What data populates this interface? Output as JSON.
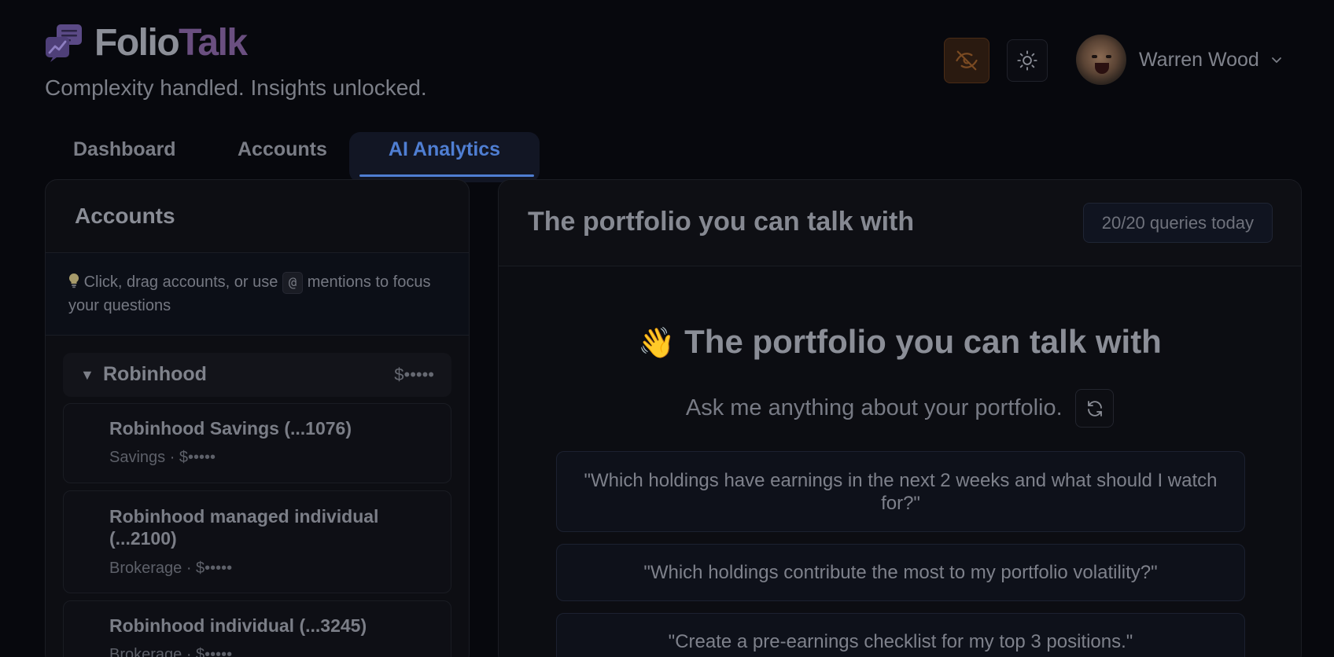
{
  "app": {
    "brand_part1": "Folio",
    "brand_part2": "Talk",
    "tagline": "Complexity handled. Insights unlocked."
  },
  "header": {
    "user_name": "Warren Wood",
    "icons": {
      "privacy_toggle": "eye-off-icon",
      "theme_toggle": "sun-icon",
      "user_menu": "chevron-down-icon"
    },
    "accent_colors": {
      "privacy_button": "#2a1a10",
      "active_tab": "#4f7ed2"
    }
  },
  "tabs": [
    {
      "label": "Dashboard",
      "active": false
    },
    {
      "label": "Accounts",
      "active": false
    },
    {
      "label": "AI Analytics",
      "active": true
    }
  ],
  "accounts_panel": {
    "title": "Accounts",
    "hint_before": "Click, drag accounts, or use",
    "hint_kbd": "@",
    "hint_after": "mentions to focus your questions",
    "groups": [
      {
        "name": "Robinhood",
        "value": "$•••••",
        "expanded": true,
        "accounts": [
          {
            "name": "Robinhood Savings (...1076)",
            "meta": "Savings · $•••••"
          },
          {
            "name": "Robinhood managed individual (...2100)",
            "meta": "Brokerage · $•••••"
          },
          {
            "name": "Robinhood individual (...3245)",
            "meta": "Brokerage · $•••••"
          }
        ]
      }
    ]
  },
  "chat_panel": {
    "title": "The portfolio you can talk with",
    "quota": "20/20 queries today",
    "welcome_emoji": "👋",
    "welcome_title": "The portfolio you can talk with",
    "subtitle": "Ask me anything about your portfolio.",
    "suggestions": [
      "\"Which holdings have earnings in the next 2 weeks and what should I watch for?\"",
      "\"Which holdings contribute the most to my portfolio volatility?\"",
      "\"Create a pre-earnings checklist for my top 3 positions.\""
    ]
  }
}
